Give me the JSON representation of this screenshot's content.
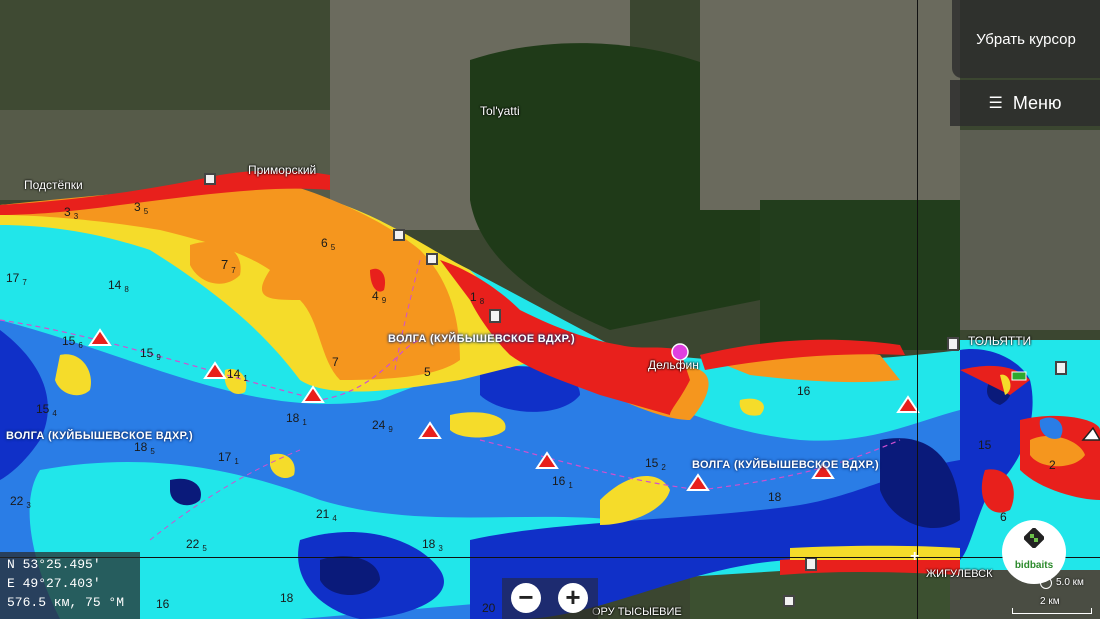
{
  "map": {
    "places": {
      "tolyatti_en": "Tol'yatti",
      "podstepki": "Подстёпки",
      "primorsky": "Приморский",
      "dolphin": "Дельфин",
      "tolyatti_ru": "ТОЛЬЯТТИ",
      "zhigulevsk": "ЖИГУЛЕВСК",
      "bottom_place": "ОРУ ТЫСЫЕВИЕ"
    },
    "river_labels": [
      "ВОЛГА (КУЙБЫШЕВСКОЕ ВДХР.)",
      "ВОЛГА (КУЙБЫШЕВСКОЕ ВДХР.)",
      "ВОЛГА (КУЙБЫШЕВСКОЕ ВДХР.)"
    ],
    "depths": [
      "3",
      "3",
      "17",
      "14",
      "7",
      "6",
      "4",
      "1",
      "15",
      "15",
      "14",
      "18",
      "24",
      "15",
      "17",
      "18",
      "16",
      "15",
      "22",
      "21",
      "22",
      "18",
      "16",
      "18",
      "5",
      "7",
      "2",
      "6",
      "15",
      "18",
      "16",
      "20"
    ],
    "depth_subs": [
      "3",
      "5",
      "7",
      "8",
      "7",
      "5",
      "9",
      "8",
      "6",
      "9",
      "1",
      "1",
      "9",
      "4",
      "1",
      "5",
      "1",
      "2",
      "3",
      "4",
      "5",
      "3"
    ]
  },
  "controls": {
    "remove_cursor": "Убрать курсор",
    "menu": "Меню",
    "zoom_out": "−",
    "zoom_in": "+"
  },
  "position": {
    "lat": "N  53°25.495'",
    "lon": "E  49°27.403'",
    "range": "576.5 км, 75 °M"
  },
  "scale": {
    "distance": "5.0 км",
    "bar": "2 км"
  },
  "brand": {
    "name": "bidbaits"
  },
  "colors": {
    "shallow_red": "#e8201c",
    "orange": "#f5961e",
    "yellow": "#f5dc2a",
    "cyan": "#21e6ea",
    "mid_blue": "#2a7de6",
    "deep_blue": "#1030c8",
    "deepest": "#0a1a7a"
  }
}
